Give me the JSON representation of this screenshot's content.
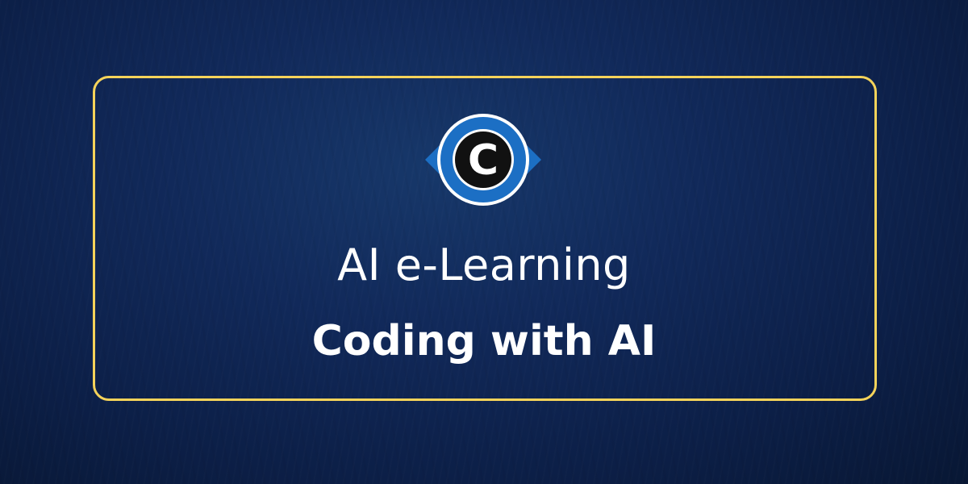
{
  "banner": {
    "title": "AI e-Learning",
    "subtitle": "Coding with AI",
    "logo_letter": "C"
  },
  "colors": {
    "background": "#11295a",
    "frame_border": "#f5d35a",
    "logo_blue": "#1c6fc4",
    "text": "#ffffff"
  },
  "icons": [
    "logo-icon"
  ]
}
